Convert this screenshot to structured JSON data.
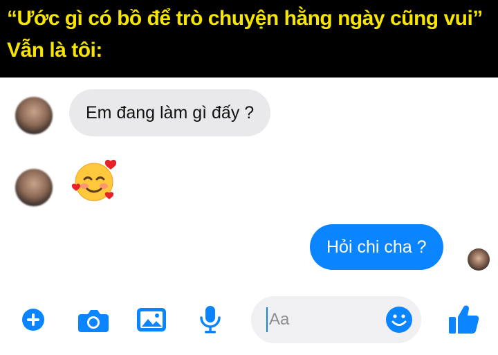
{
  "caption": {
    "line1": "“Ước gì có bồ để trò chuyện hằng ngày cũng vui”",
    "line2": "Vẫn là tôi:"
  },
  "messages": [
    {
      "direction": "incoming",
      "text": "Em đang làm gì đấy ?"
    },
    {
      "direction": "incoming",
      "emoji": "smiling-face-with-hearts"
    },
    {
      "direction": "outgoing",
      "text": "Hỏi chi cha ?"
    }
  ],
  "composer": {
    "placeholder": "Aa"
  },
  "icons": {
    "plus": "plus-circle-icon",
    "camera": "camera-icon",
    "image": "image-icon",
    "mic": "microphone-icon",
    "emoji": "smiley-icon",
    "like": "thumbs-up-icon"
  },
  "colors": {
    "accent": "#0a84ff",
    "incoming_bubble": "#e9e9eb",
    "caption_text": "#f5e500",
    "caption_bg": "#000000"
  }
}
